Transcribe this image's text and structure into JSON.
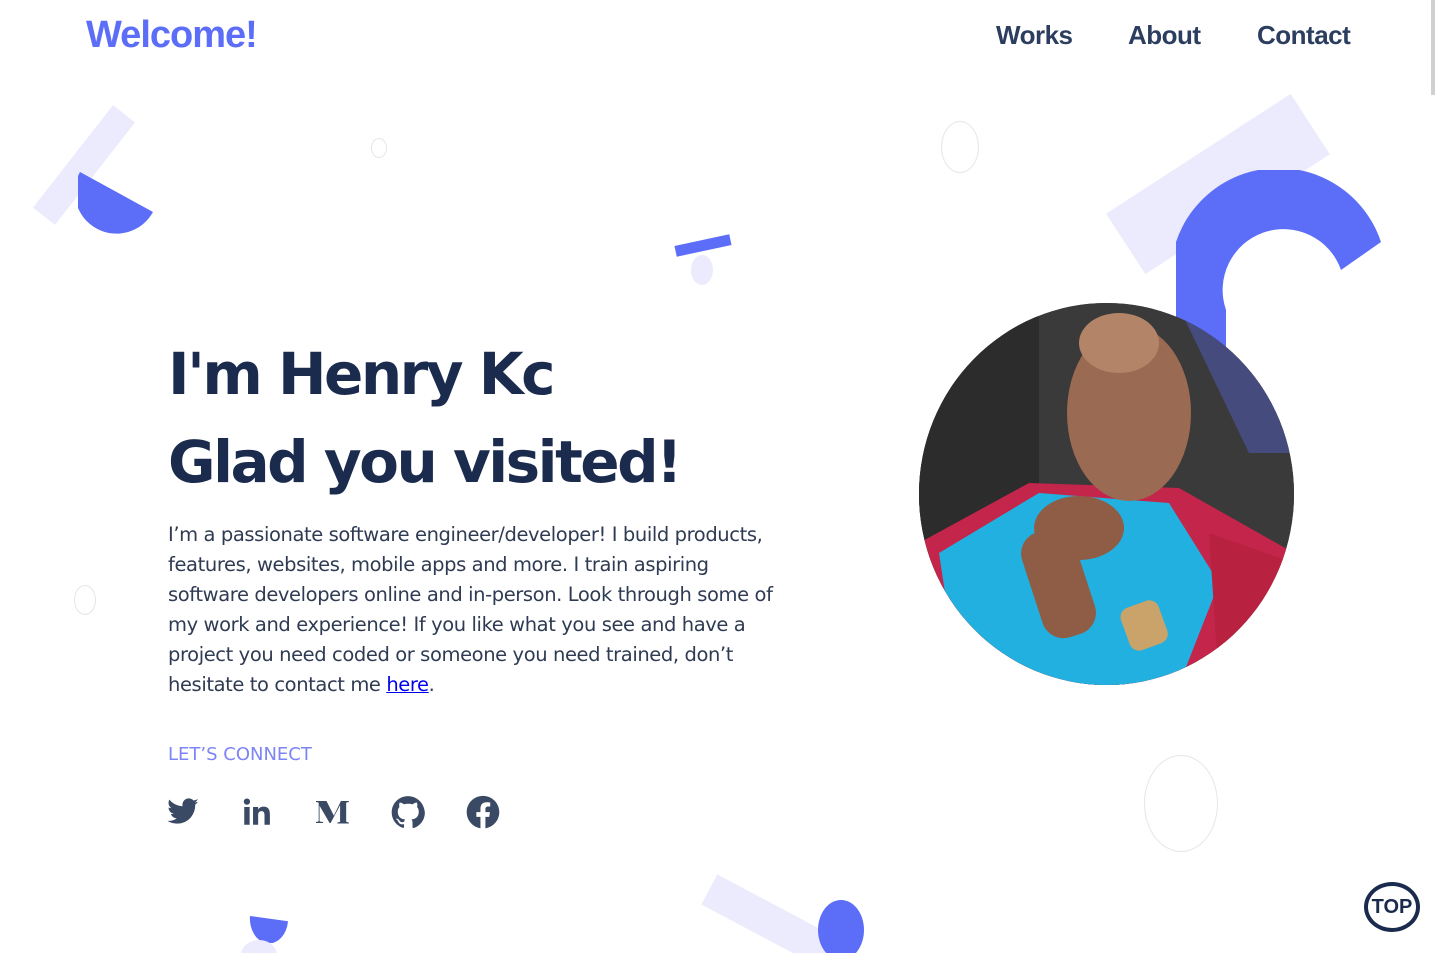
{
  "header": {
    "logo": "Welcome!",
    "nav": [
      {
        "label": "Works"
      },
      {
        "label": "About"
      },
      {
        "label": "Contact"
      }
    ]
  },
  "hero": {
    "line1": "I'm Henry Kc",
    "line2": "Glad you visited!",
    "intro": "I’m a passionate software engineer/developer! I build products, features, websites, mobile apps and more. I train aspiring software developers online and in-person. Look through some of my work and experience! If you like what you see and have a project you need coded or someone you need trained, don’t hesitate to contact me ",
    "intro_link": "here",
    "intro_end": ".",
    "connect_label": "LET’S CONNECT",
    "socials": [
      {
        "icon": "twitter-icon"
      },
      {
        "icon": "linkedin-icon"
      },
      {
        "icon": "medium-icon"
      },
      {
        "icon": "github-icon"
      },
      {
        "icon": "facebook-icon"
      }
    ]
  },
  "top_button": "TOP",
  "colors": {
    "accent": "#5c6ef8",
    "accent_light": "#ebebfd",
    "heading": "#1b2b4d",
    "body": "#2f3b52",
    "connect": "#7d84f5"
  }
}
